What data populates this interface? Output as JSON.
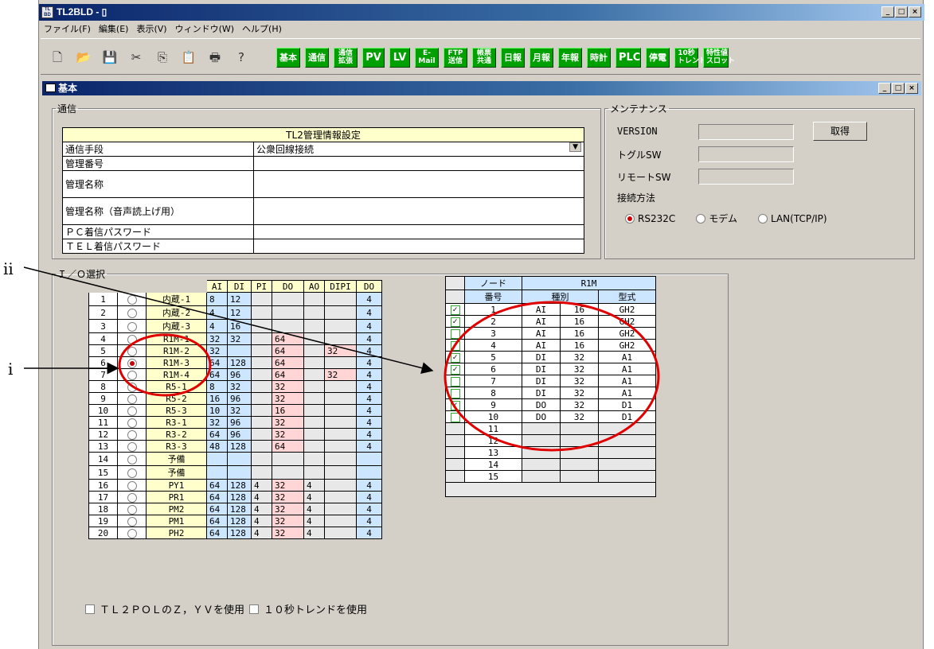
{
  "window": {
    "title": "TL2BLD - ▯",
    "icon_text": "TL2\nBLD",
    "menu": [
      "ファイル(F)",
      "編集(E)",
      "表示(V)",
      "ウィンドウ(W)",
      "ヘルプ(H)"
    ]
  },
  "toolbar": {
    "std_icons": [
      "new-icon",
      "open-icon",
      "save-icon",
      "cut-icon",
      "copy-icon",
      "paste-icon",
      "print-icon",
      "help-icon"
    ],
    "buttons": [
      "基本",
      "通信",
      "通信\n拡張",
      "PV",
      "LV",
      "E-\nMail",
      "FTP\n送信",
      "帳票\n共通",
      "日報",
      "月報",
      "年報",
      "時計",
      "PLC",
      "停電",
      "10秒\nトレンド",
      "特性値\nスロット"
    ]
  },
  "child": {
    "title": "基本"
  },
  "comm": {
    "legend": "通信",
    "header": "TL2管理情報設定",
    "rows": [
      {
        "label": "通信手段",
        "value": "公衆回線接続"
      },
      {
        "label": "管理番号",
        "value": ""
      },
      {
        "label": "管理名称",
        "value": ""
      },
      {
        "label": "管理名称（音声読上げ用）",
        "value": ""
      },
      {
        "label": "ＰＣ着信パスワード",
        "value": ""
      },
      {
        "label": "ＴＥＬ着信パスワード",
        "value": ""
      }
    ]
  },
  "maint": {
    "legend": "メンテナンス",
    "version": "VERSION",
    "toggle": "トグルSW",
    "remote": "リモートSW",
    "get_button": "取得",
    "method": "接続方法",
    "options": [
      {
        "label": "RS232C",
        "selected": true
      },
      {
        "label": "モデム",
        "selected": false
      },
      {
        "label": "LAN(TCP/IP)",
        "selected": false
      }
    ]
  },
  "io": {
    "legend": "Ｉ／Ｏ選択",
    "headers": [
      "AI",
      "DI",
      "PI",
      "DO",
      "AO",
      "DIPI",
      "DO"
    ],
    "rows": [
      {
        "n": "1",
        "name": "内蔵-1",
        "AI": "8",
        "DI": "12",
        "PI": "",
        "DO": "",
        "AO": "",
        "DIPI": "",
        "DO2": "4",
        "sel": false
      },
      {
        "n": "2",
        "name": "内蔵-2",
        "AI": "4",
        "DI": "12",
        "PI": "",
        "DO": "",
        "AO": "",
        "DIPI": "",
        "DO2": "4",
        "sel": false
      },
      {
        "n": "3",
        "name": "内蔵-3",
        "AI": "4",
        "DI": "16",
        "PI": "",
        "DO": "",
        "AO": "",
        "DIPI": "",
        "DO2": "4",
        "sel": false
      },
      {
        "n": "4",
        "name": "R1M-1",
        "AI": "32",
        "DI": "32",
        "PI": "",
        "DO": "64",
        "AO": "",
        "DIPI": "",
        "DO2": "4",
        "sel": false
      },
      {
        "n": "5",
        "name": "R1M-2",
        "AI": "32",
        "DI": "",
        "PI": "",
        "DO": "64",
        "AO": "",
        "DIPI": "32",
        "DO2": "4",
        "sel": false
      },
      {
        "n": "6",
        "name": "R1M-3",
        "AI": "64",
        "DI": "128",
        "PI": "",
        "DO": "64",
        "AO": "",
        "DIPI": "",
        "DO2": "4",
        "sel": true
      },
      {
        "n": "7",
        "name": "R1M-4",
        "AI": "64",
        "DI": "96",
        "PI": "",
        "DO": "64",
        "AO": "",
        "DIPI": "32",
        "DO2": "4",
        "sel": false
      },
      {
        "n": "8",
        "name": "R5-1",
        "AI": "8",
        "DI": "32",
        "PI": "",
        "DO": "32",
        "AO": "",
        "DIPI": "",
        "DO2": "4",
        "sel": false
      },
      {
        "n": "9",
        "name": "R5-2",
        "AI": "16",
        "DI": "96",
        "PI": "",
        "DO": "32",
        "AO": "",
        "DIPI": "",
        "DO2": "4",
        "sel": false
      },
      {
        "n": "10",
        "name": "R5-3",
        "AI": "10",
        "DI": "32",
        "PI": "",
        "DO": "16",
        "AO": "",
        "DIPI": "",
        "DO2": "4",
        "sel": false
      },
      {
        "n": "11",
        "name": "R3-1",
        "AI": "32",
        "DI": "96",
        "PI": "",
        "DO": "32",
        "AO": "",
        "DIPI": "",
        "DO2": "4",
        "sel": false
      },
      {
        "n": "12",
        "name": "R3-2",
        "AI": "64",
        "DI": "96",
        "PI": "",
        "DO": "32",
        "AO": "",
        "DIPI": "",
        "DO2": "4",
        "sel": false
      },
      {
        "n": "13",
        "name": "R3-3",
        "AI": "48",
        "DI": "128",
        "PI": "",
        "DO": "64",
        "AO": "",
        "DIPI": "",
        "DO2": "4",
        "sel": false
      },
      {
        "n": "14",
        "name": "予備",
        "AI": "",
        "DI": "",
        "PI": "",
        "DO": "",
        "AO": "",
        "DIPI": "",
        "DO2": "",
        "sel": false
      },
      {
        "n": "15",
        "name": "予備",
        "AI": "",
        "DI": "",
        "PI": "",
        "DO": "",
        "AO": "",
        "DIPI": "",
        "DO2": "",
        "sel": false
      },
      {
        "n": "16",
        "name": "PY1",
        "AI": "64",
        "DI": "128",
        "PI": "4",
        "DO": "32",
        "AO": "4",
        "DIPI": "",
        "DO2": "4",
        "sel": false
      },
      {
        "n": "17",
        "name": "PR1",
        "AI": "64",
        "DI": "128",
        "PI": "4",
        "DO": "32",
        "AO": "4",
        "DIPI": "",
        "DO2": "4",
        "sel": false
      },
      {
        "n": "18",
        "name": "PM2",
        "AI": "64",
        "DI": "128",
        "PI": "4",
        "DO": "32",
        "AO": "4",
        "DIPI": "",
        "DO2": "4",
        "sel": false
      },
      {
        "n": "19",
        "name": "PM1",
        "AI": "64",
        "DI": "128",
        "PI": "4",
        "DO": "32",
        "AO": "4",
        "DIPI": "",
        "DO2": "4",
        "sel": false
      },
      {
        "n": "20",
        "name": "PH2",
        "AI": "64",
        "DI": "128",
        "PI": "4",
        "DO": "32",
        "AO": "4",
        "DIPI": "",
        "DO2": "4",
        "sel": false
      }
    ]
  },
  "node": {
    "h1": "ノード",
    "h2": "R1M",
    "c1": "番号",
    "c2": "種別",
    "c3": "型式",
    "rows": [
      {
        "chk": true,
        "n": "1",
        "t": "AI",
        "c": "16",
        "m": "GH2"
      },
      {
        "chk": true,
        "n": "2",
        "t": "AI",
        "c": "16",
        "m": "GH2"
      },
      {
        "chk": false,
        "n": "3",
        "t": "AI",
        "c": "16",
        "m": "GH2"
      },
      {
        "chk": false,
        "n": "4",
        "t": "AI",
        "c": "16",
        "m": "GH2"
      },
      {
        "chk": true,
        "n": "5",
        "t": "DI",
        "c": "32",
        "m": "A1"
      },
      {
        "chk": true,
        "n": "6",
        "t": "DI",
        "c": "32",
        "m": "A1"
      },
      {
        "chk": false,
        "n": "7",
        "t": "DI",
        "c": "32",
        "m": "A1"
      },
      {
        "chk": false,
        "n": "8",
        "t": "DI",
        "c": "32",
        "m": "A1"
      },
      {
        "chk": true,
        "n": "9",
        "t": "DO",
        "c": "32",
        "m": "D1"
      },
      {
        "chk": false,
        "n": "10",
        "t": "DO",
        "c": "32",
        "m": "D1"
      },
      {
        "chk": null,
        "n": "11",
        "t": "",
        "c": "",
        "m": ""
      },
      {
        "chk": null,
        "n": "12",
        "t": "",
        "c": "",
        "m": ""
      },
      {
        "chk": null,
        "n": "13",
        "t": "",
        "c": "",
        "m": ""
      },
      {
        "chk": null,
        "n": "14",
        "t": "",
        "c": "",
        "m": ""
      },
      {
        "chk": null,
        "n": "15",
        "t": "",
        "c": "",
        "m": ""
      }
    ]
  },
  "options": {
    "opt1": "ＴＬ２ＰＯＬのＺ，ＹＶを使用",
    "opt2": "１０秒トレンドを使用"
  },
  "annotations": {
    "i": "i",
    "ii": "ii"
  },
  "colors": {
    "green": "#00a000",
    "red_annotation": "#e00000",
    "title_blue": "#0a246a"
  }
}
